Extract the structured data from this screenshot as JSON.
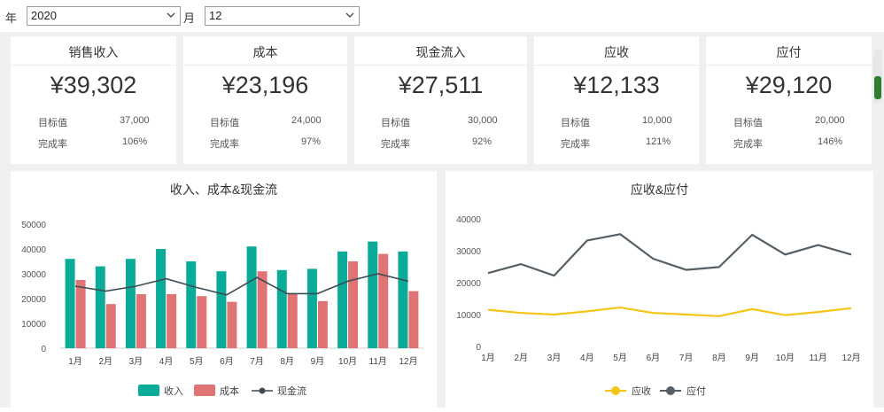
{
  "filters": {
    "year_label": "年",
    "year_value": "2020",
    "month_label": "月",
    "month_value": "12"
  },
  "kpis": [
    {
      "title": "销售收入",
      "value": "¥39,302",
      "target_label": "目标值",
      "target": "37,000",
      "rate_label": "完成率",
      "rate": "106%",
      "rate_color": "#1aa38d"
    },
    {
      "title": "成本",
      "value": "¥23,196",
      "target_label": "目标值",
      "target": "24,000",
      "rate_label": "完成率",
      "rate": "97%",
      "rate_color": "#1aa38d"
    },
    {
      "title": "现金流入",
      "value": "¥27,511",
      "target_label": "目标值",
      "target": "30,000",
      "rate_label": "完成率",
      "rate": "92%",
      "rate_color": "#e0201a"
    },
    {
      "title": "应收",
      "value": "¥12,133",
      "target_label": "目标值",
      "target": "10,000",
      "rate_label": "完成率",
      "rate": "121%",
      "rate_color": "#e0201a"
    },
    {
      "title": "应付",
      "value": "¥29,120",
      "target_label": "目标值",
      "target": "20,000",
      "rate_label": "完成率",
      "rate": "146%",
      "rate_color": "#e0201a"
    }
  ],
  "chart_data": [
    {
      "type": "bar",
      "title": "收入、成本&现金流",
      "categories": [
        "1月",
        "2月",
        "3月",
        "4月",
        "5月",
        "6月",
        "7月",
        "8月",
        "9月",
        "10月",
        "11月",
        "12月"
      ],
      "ylim": [
        0,
        50000
      ],
      "yticks": [
        "0",
        "10000",
        "20000",
        "30000",
        "40000",
        "50000"
      ],
      "series": [
        {
          "name": "收入",
          "kind": "bar",
          "color": "#0aab98",
          "values": [
            36000,
            33000,
            36000,
            40000,
            35000,
            31000,
            41000,
            31500,
            32000,
            39000,
            43000,
            39000
          ]
        },
        {
          "name": "成本",
          "kind": "bar",
          "color": "#e07474",
          "values": [
            27500,
            17800,
            21800,
            21800,
            21000,
            18700,
            31000,
            22000,
            19000,
            35000,
            38000,
            23000
          ]
        },
        {
          "name": "现金流",
          "kind": "line",
          "color": "#3d4b54",
          "values": [
            25000,
            23000,
            25000,
            28000,
            24500,
            21500,
            28500,
            22000,
            22000,
            27000,
            30000,
            27000
          ]
        }
      ],
      "legend": "bottom"
    },
    {
      "type": "line",
      "title": "应收&应付",
      "categories": [
        "1月",
        "2月",
        "3月",
        "4月",
        "5月",
        "6月",
        "7月",
        "8月",
        "9月",
        "10月",
        "11月",
        "12月"
      ],
      "ylim": [
        0,
        40000
      ],
      "yticks": [
        "0",
        "10000",
        "20000",
        "30000",
        "40000"
      ],
      "series": [
        {
          "name": "应收",
          "color": "#f5c518",
          "values": [
            11500,
            10500,
            10000,
            11000,
            12200,
            10500,
            10000,
            9500,
            11700,
            9800,
            10800,
            12000
          ]
        },
        {
          "name": "应付",
          "color": "#555f66",
          "values": [
            23000,
            25800,
            22200,
            33200,
            35200,
            27500,
            24000,
            24900,
            35000,
            28800,
            31800,
            28800
          ]
        }
      ],
      "legend": "bottom"
    }
  ]
}
